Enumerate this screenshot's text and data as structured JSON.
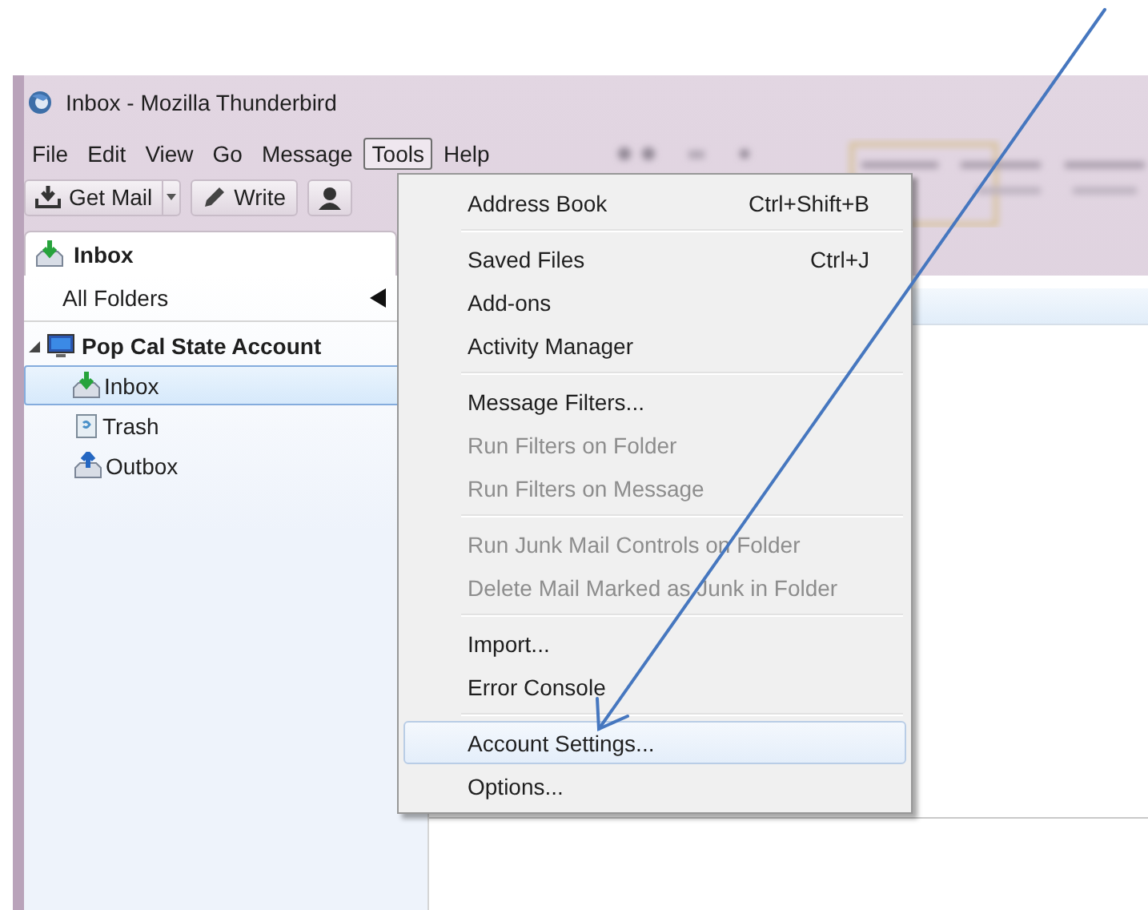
{
  "window": {
    "title": "Inbox - Mozilla Thunderbird"
  },
  "menu_bar": [
    {
      "label": "File",
      "selected": false
    },
    {
      "label": "Edit",
      "selected": false
    },
    {
      "label": "View",
      "selected": false
    },
    {
      "label": "Go",
      "selected": false
    },
    {
      "label": "Message",
      "selected": false
    },
    {
      "label": "Tools",
      "selected": true
    },
    {
      "label": "Help",
      "selected": false
    }
  ],
  "toolbar": [
    {
      "label": "Get Mail",
      "kind": "split"
    },
    {
      "label": "Write",
      "kind": "button"
    }
  ],
  "tab": {
    "label": "Inbox"
  },
  "folder_pane": {
    "header": "All Folders",
    "tree": [
      {
        "label": "Pop Cal State Account",
        "expanded": true,
        "children": [
          {
            "label": "Inbox",
            "selected": true,
            "kind": "inbox"
          },
          {
            "label": "Trash",
            "selected": false,
            "kind": "trash"
          },
          {
            "label": "Outbox",
            "selected": false,
            "kind": "outbox"
          }
        ]
      }
    ]
  },
  "tools_menu": [
    {
      "kind": "item",
      "label": "Address Book",
      "shortcut": "Ctrl+Shift+B",
      "disabled": false,
      "selected": false
    },
    {
      "kind": "separator"
    },
    {
      "kind": "item",
      "label": "Saved Files",
      "shortcut": "Ctrl+J",
      "disabled": false,
      "selected": false
    },
    {
      "kind": "item",
      "label": "Add-ons",
      "disabled": false,
      "selected": false
    },
    {
      "kind": "item",
      "label": "Activity Manager",
      "disabled": false,
      "selected": false
    },
    {
      "kind": "separator"
    },
    {
      "kind": "item",
      "label": "Message Filters...",
      "disabled": false,
      "selected": false
    },
    {
      "kind": "item",
      "label": "Run Filters on Folder",
      "disabled": true,
      "selected": false
    },
    {
      "kind": "item",
      "label": "Run Filters on Message",
      "disabled": true,
      "selected": false
    },
    {
      "kind": "separator"
    },
    {
      "kind": "item",
      "label": "Run Junk Mail Controls on Folder",
      "disabled": true,
      "selected": false
    },
    {
      "kind": "item",
      "label": "Delete Mail Marked as Junk in Folder",
      "disabled": true,
      "selected": false
    },
    {
      "kind": "separator"
    },
    {
      "kind": "item",
      "label": "Import...",
      "disabled": false,
      "selected": false
    },
    {
      "kind": "item",
      "label": "Error Console",
      "disabled": false,
      "selected": false
    },
    {
      "kind": "separator"
    },
    {
      "kind": "item",
      "label": "Account Settings...",
      "disabled": false,
      "selected": true
    },
    {
      "kind": "item",
      "label": "Options...",
      "disabled": false,
      "selected": false
    }
  ]
}
